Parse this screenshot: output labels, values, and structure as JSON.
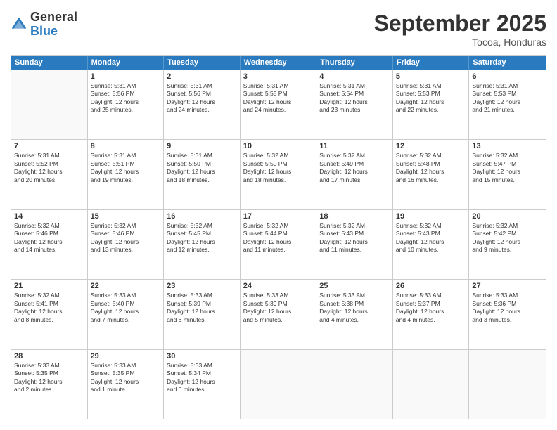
{
  "logo": {
    "general": "General",
    "blue": "Blue"
  },
  "title": "September 2025",
  "location": "Tocoa, Honduras",
  "header_days": [
    "Sunday",
    "Monday",
    "Tuesday",
    "Wednesday",
    "Thursday",
    "Friday",
    "Saturday"
  ],
  "weeks": [
    [
      {
        "day": "",
        "info": ""
      },
      {
        "day": "1",
        "info": "Sunrise: 5:31 AM\nSunset: 5:56 PM\nDaylight: 12 hours\nand 25 minutes."
      },
      {
        "day": "2",
        "info": "Sunrise: 5:31 AM\nSunset: 5:56 PM\nDaylight: 12 hours\nand 24 minutes."
      },
      {
        "day": "3",
        "info": "Sunrise: 5:31 AM\nSunset: 5:55 PM\nDaylight: 12 hours\nand 24 minutes."
      },
      {
        "day": "4",
        "info": "Sunrise: 5:31 AM\nSunset: 5:54 PM\nDaylight: 12 hours\nand 23 minutes."
      },
      {
        "day": "5",
        "info": "Sunrise: 5:31 AM\nSunset: 5:53 PM\nDaylight: 12 hours\nand 22 minutes."
      },
      {
        "day": "6",
        "info": "Sunrise: 5:31 AM\nSunset: 5:53 PM\nDaylight: 12 hours\nand 21 minutes."
      }
    ],
    [
      {
        "day": "7",
        "info": "Sunrise: 5:31 AM\nSunset: 5:52 PM\nDaylight: 12 hours\nand 20 minutes."
      },
      {
        "day": "8",
        "info": "Sunrise: 5:31 AM\nSunset: 5:51 PM\nDaylight: 12 hours\nand 19 minutes."
      },
      {
        "day": "9",
        "info": "Sunrise: 5:31 AM\nSunset: 5:50 PM\nDaylight: 12 hours\nand 18 minutes."
      },
      {
        "day": "10",
        "info": "Sunrise: 5:32 AM\nSunset: 5:50 PM\nDaylight: 12 hours\nand 18 minutes."
      },
      {
        "day": "11",
        "info": "Sunrise: 5:32 AM\nSunset: 5:49 PM\nDaylight: 12 hours\nand 17 minutes."
      },
      {
        "day": "12",
        "info": "Sunrise: 5:32 AM\nSunset: 5:48 PM\nDaylight: 12 hours\nand 16 minutes."
      },
      {
        "day": "13",
        "info": "Sunrise: 5:32 AM\nSunset: 5:47 PM\nDaylight: 12 hours\nand 15 minutes."
      }
    ],
    [
      {
        "day": "14",
        "info": "Sunrise: 5:32 AM\nSunset: 5:46 PM\nDaylight: 12 hours\nand 14 minutes."
      },
      {
        "day": "15",
        "info": "Sunrise: 5:32 AM\nSunset: 5:46 PM\nDaylight: 12 hours\nand 13 minutes."
      },
      {
        "day": "16",
        "info": "Sunrise: 5:32 AM\nSunset: 5:45 PM\nDaylight: 12 hours\nand 12 minutes."
      },
      {
        "day": "17",
        "info": "Sunrise: 5:32 AM\nSunset: 5:44 PM\nDaylight: 12 hours\nand 11 minutes."
      },
      {
        "day": "18",
        "info": "Sunrise: 5:32 AM\nSunset: 5:43 PM\nDaylight: 12 hours\nand 11 minutes."
      },
      {
        "day": "19",
        "info": "Sunrise: 5:32 AM\nSunset: 5:43 PM\nDaylight: 12 hours\nand 10 minutes."
      },
      {
        "day": "20",
        "info": "Sunrise: 5:32 AM\nSunset: 5:42 PM\nDaylight: 12 hours\nand 9 minutes."
      }
    ],
    [
      {
        "day": "21",
        "info": "Sunrise: 5:32 AM\nSunset: 5:41 PM\nDaylight: 12 hours\nand 8 minutes."
      },
      {
        "day": "22",
        "info": "Sunrise: 5:33 AM\nSunset: 5:40 PM\nDaylight: 12 hours\nand 7 minutes."
      },
      {
        "day": "23",
        "info": "Sunrise: 5:33 AM\nSunset: 5:39 PM\nDaylight: 12 hours\nand 6 minutes."
      },
      {
        "day": "24",
        "info": "Sunrise: 5:33 AM\nSunset: 5:39 PM\nDaylight: 12 hours\nand 5 minutes."
      },
      {
        "day": "25",
        "info": "Sunrise: 5:33 AM\nSunset: 5:38 PM\nDaylight: 12 hours\nand 4 minutes."
      },
      {
        "day": "26",
        "info": "Sunrise: 5:33 AM\nSunset: 5:37 PM\nDaylight: 12 hours\nand 4 minutes."
      },
      {
        "day": "27",
        "info": "Sunrise: 5:33 AM\nSunset: 5:36 PM\nDaylight: 12 hours\nand 3 minutes."
      }
    ],
    [
      {
        "day": "28",
        "info": "Sunrise: 5:33 AM\nSunset: 5:35 PM\nDaylight: 12 hours\nand 2 minutes."
      },
      {
        "day": "29",
        "info": "Sunrise: 5:33 AM\nSunset: 5:35 PM\nDaylight: 12 hours\nand 1 minute."
      },
      {
        "day": "30",
        "info": "Sunrise: 5:33 AM\nSunset: 5:34 PM\nDaylight: 12 hours\nand 0 minutes."
      },
      {
        "day": "",
        "info": ""
      },
      {
        "day": "",
        "info": ""
      },
      {
        "day": "",
        "info": ""
      },
      {
        "day": "",
        "info": ""
      }
    ]
  ]
}
